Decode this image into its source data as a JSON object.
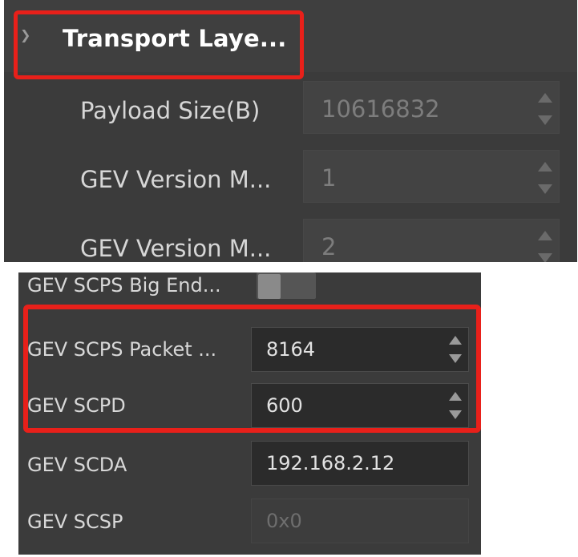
{
  "top_panel": {
    "section_title": "Transport Laye...",
    "chevron_icon": "chevron-down-icon",
    "properties": [
      {
        "label": "Payload Size(B)",
        "value": "10616832"
      },
      {
        "label": "GEV Version M...",
        "value": "1"
      },
      {
        "label": "GEV Version M...",
        "value": "2"
      }
    ]
  },
  "bottom_panel": {
    "big_endian": {
      "label": "GEV SCPS Big End...",
      "state": "off"
    },
    "properties": [
      {
        "label": "GEV SCPS Packet ...",
        "value": "8164"
      },
      {
        "label": "GEV SCPD",
        "value": "600"
      },
      {
        "label": "GEV SCDA",
        "value": "192.168.2.12"
      },
      {
        "label": "GEV SCSP",
        "value": "0x0"
      }
    ]
  },
  "colors": {
    "highlight": "#e8201a",
    "panel_bg": "#3b3b3b",
    "field_bg": "#2b2b2b"
  }
}
